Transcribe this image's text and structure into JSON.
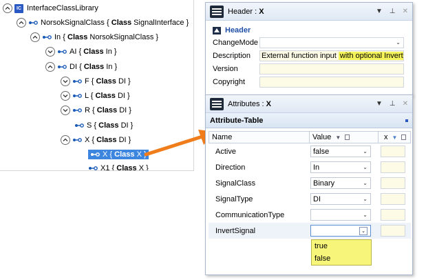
{
  "tree": {
    "root": {
      "label": "InterfaceClassLibrary",
      "icon_text": "IC"
    },
    "nodes": [
      {
        "name": "NorsokSignalClass",
        "open": "{",
        "kw": "Class",
        "cls": "SignalInterface",
        "close": "}"
      },
      {
        "name": "In",
        "open": "{",
        "kw": "Class",
        "cls": "NorsokSignalClass",
        "close": "}"
      },
      {
        "name": "AI",
        "open": "{",
        "kw": "Class",
        "cls": "In",
        "close": "}"
      },
      {
        "name": "DI",
        "open": "{",
        "kw": "Class",
        "cls": "In",
        "close": "}"
      },
      {
        "name": "F",
        "open": "{",
        "kw": "Class",
        "cls": "DI",
        "close": "}"
      },
      {
        "name": "L",
        "open": "{",
        "kw": "Class",
        "cls": "DI",
        "close": "}"
      },
      {
        "name": "R",
        "open": "{",
        "kw": "Class",
        "cls": "DI",
        "close": "}"
      },
      {
        "name": "S",
        "open": "{",
        "kw": "Class",
        "cls": "DI",
        "close": "}"
      },
      {
        "name": "X",
        "open": "{",
        "kw": "Class",
        "cls": "DI",
        "close": "}"
      },
      {
        "name": "X",
        "open": "{",
        "kw": "Class",
        "cls": "X",
        "close": "}"
      },
      {
        "name": "X1",
        "open": "{",
        "kw": "Class",
        "cls": "X",
        "close": "}"
      }
    ]
  },
  "header_panel": {
    "title_prefix": "Header :",
    "title_name": "X",
    "section": "Header",
    "rows": [
      {
        "label": "ChangeMode",
        "value": ""
      },
      {
        "label": "Description",
        "value_plain": "External function input",
        "value_hl": "with optional Invert"
      },
      {
        "label": "Version",
        "value": ""
      },
      {
        "label": "Copyright",
        "value": ""
      }
    ]
  },
  "attr_panel": {
    "title_prefix": "Attributes :",
    "title_name": "X",
    "table_title": "Attribute-Table",
    "columns": {
      "name": "Name",
      "value": "Value",
      "x": "x"
    },
    "rows": [
      {
        "name": "Active",
        "value": "false"
      },
      {
        "name": "Direction",
        "value": "In"
      },
      {
        "name": "SignalClass",
        "value": "Binary"
      },
      {
        "name": "SignalType",
        "value": "DI"
      },
      {
        "name": "CommunicationType",
        "value": ""
      },
      {
        "name": "InvertSignal",
        "value": ""
      }
    ],
    "dropdown_options": [
      "true",
      "false"
    ]
  },
  "colors": {
    "accent": "#1f4fa8",
    "selection": "#3c86e0",
    "highlight": "#f5f35a",
    "arrow": "#f07d1c"
  }
}
